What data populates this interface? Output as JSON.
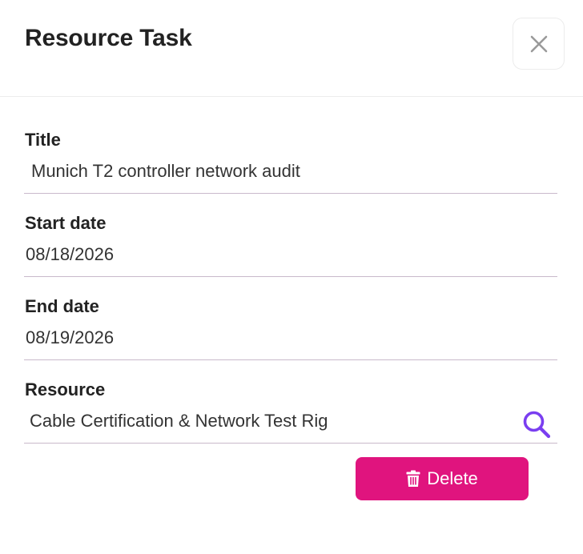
{
  "dialog": {
    "title": "Resource Task",
    "close_icon": "close-icon"
  },
  "fields": [
    {
      "label": "Title",
      "value": "Munich T2 controller network audit"
    },
    {
      "label": "Start date",
      "value": "08/18/2026"
    },
    {
      "label": "End date",
      "value": "08/19/2026"
    },
    {
      "label": "Resource",
      "value": "Cable Certification & Network Test Rig",
      "icon": "search-icon"
    }
  ],
  "actions": {
    "delete_label": "Delete",
    "delete_icon": "trash-icon"
  },
  "colors": {
    "accent": "#e0147e",
    "search_icon": "#7a3ef0",
    "divider": "#c9b9cb"
  }
}
